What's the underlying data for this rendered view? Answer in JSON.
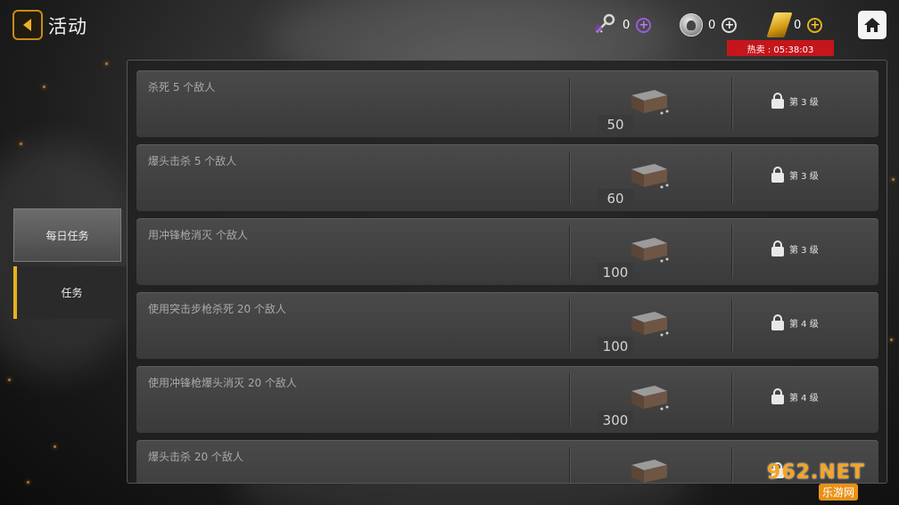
{
  "header": {
    "title": "活动",
    "currencies": [
      {
        "name": "keys",
        "amount": "0",
        "icon": "key-icon",
        "color": "#9a5bd8"
      },
      {
        "name": "silver",
        "amount": "0",
        "icon": "silver-coin-icon",
        "color": "#dddddd"
      },
      {
        "name": "gold",
        "amount": "0",
        "icon": "gold-bar-icon",
        "color": "#e4b21c"
      }
    ],
    "plus_symbol": "+",
    "hot_sale": "热卖 : 05:38:03"
  },
  "tabs": [
    {
      "label": "每日任务",
      "active": false
    },
    {
      "label": "任务",
      "active": true
    }
  ],
  "missions": [
    {
      "description": "杀死 5 个敌人",
      "reward": "50",
      "lock_label": "第 3 级"
    },
    {
      "description": "爆头击杀 5 个敌人",
      "reward": "60",
      "lock_label": "第 3 级"
    },
    {
      "description": "用冲锋枪消灭 个敌人",
      "reward": "100",
      "lock_label": "第 3 级"
    },
    {
      "description": "使用突击步枪杀死 20 个敌人",
      "reward": "100",
      "lock_label": "第 4 级"
    },
    {
      "description": "使用冲锋枪爆头消灭 20 个敌人",
      "reward": "300",
      "lock_label": "第 4 级"
    },
    {
      "description": "爆头击杀 20 个敌人",
      "reward": "",
      "lock_label": ""
    }
  ],
  "watermark": {
    "top": "962.NET",
    "bottom": "乐游网"
  },
  "colors": {
    "accent": "#e8b21d",
    "hot_sale_bg": "#c4161c"
  }
}
